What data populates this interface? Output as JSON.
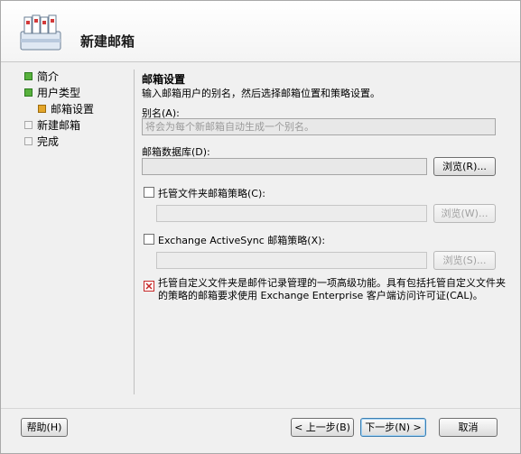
{
  "wizard": {
    "title": "新建邮箱"
  },
  "nav": {
    "items": [
      {
        "label": "简介",
        "state": "done"
      },
      {
        "label": "用户类型",
        "state": "done"
      },
      {
        "label": "邮箱设置",
        "state": "current"
      },
      {
        "label": "新建邮箱",
        "state": "pending"
      },
      {
        "label": "完成",
        "state": "pending"
      }
    ]
  },
  "section": {
    "title": "邮箱设置",
    "description": "输入邮箱用户的别名，然后选择邮箱位置和策略设置。"
  },
  "alias": {
    "label": "别名(A):",
    "placeholder": "将会为每个新邮箱自动生成一个别名。"
  },
  "database": {
    "label": "邮箱数据库(D):",
    "value": "",
    "browse_label": "浏览(R)..."
  },
  "managed_folder": {
    "label": "托管文件夹邮箱策略(C):",
    "value": "",
    "browse_label": "浏览(W)..."
  },
  "activesync": {
    "label": "Exchange ActiveSync 邮箱策略(X):",
    "value": "",
    "browse_label": "浏览(S)..."
  },
  "info": {
    "text": "托管自定义文件夹是邮件记录管理的一项高级功能。具有包括托管自定义文件夹的策略的邮箱要求使用 Exchange Enterprise 客户端访问许可证(CAL)。"
  },
  "footer": {
    "help_label": "帮助(H)",
    "back_label": "< 上一步(B)",
    "next_label": "下一步(N) >",
    "cancel_label": "取消"
  },
  "colors": {
    "done": "#58b13d",
    "current": "#e4a62a",
    "pending": "#f4f4f4"
  }
}
